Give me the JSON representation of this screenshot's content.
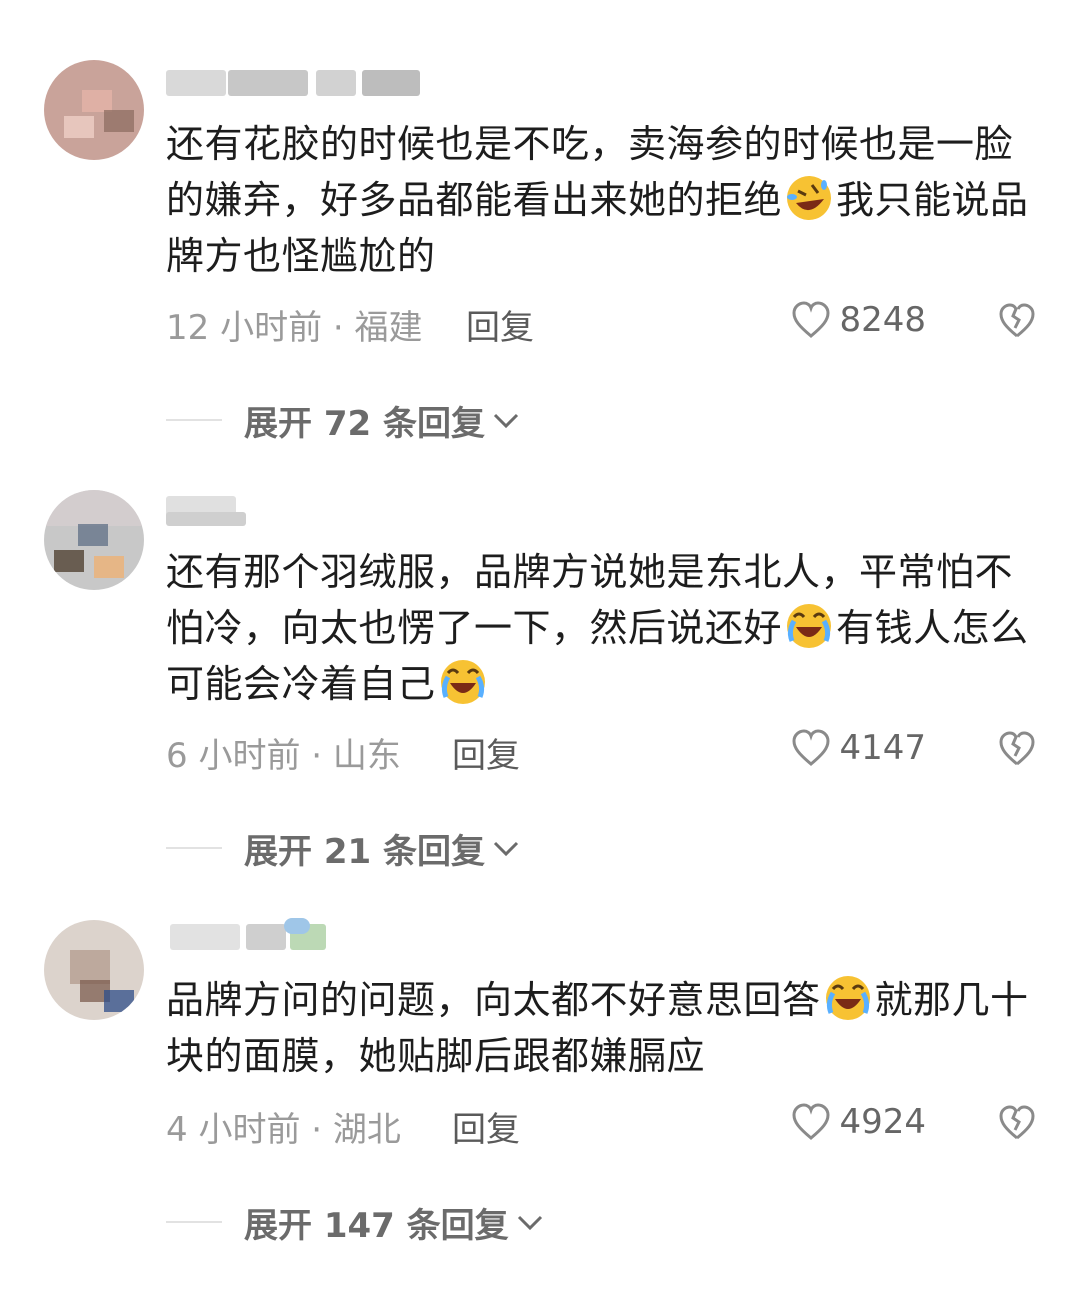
{
  "comments": [
    {
      "avatar_colors": [
        "#c9a39a",
        "#e6b4a8",
        "#8e6e62"
      ],
      "text_parts": [
        "还有花胶的时候也是不吃，卖海参的时候也是一脸的嫌弃，好多品都能看出来她的拒绝",
        "我只能说品牌方也怪尴尬的"
      ],
      "emoji": "rofl-emoji",
      "time_location": "12 小时前 · 福建",
      "reply_label": "回复",
      "likes": "8248",
      "expand_label": "展开 72 条回复"
    },
    {
      "avatar_colors": [
        "#c8c8c8",
        "#5f6f85",
        "#f0b070"
      ],
      "text_parts": [
        "还有那个羽绒服，品牌方说她是东北人，平常怕不怕冷，向太也愣了一下，然后说还好",
        "有钱人怎么可能会冷着自己"
      ],
      "emoji": "crying-laughing-emoji",
      "time_location": "6 小时前 · 山东",
      "reply_label": "回复",
      "likes": "4147",
      "expand_label": "展开 21 条回复"
    },
    {
      "avatar_colors": [
        "#dcd3cc",
        "#b39b8e",
        "#7d5d50"
      ],
      "text_parts": [
        "品牌方问的问题，向太都不好意思回答",
        "就那几十块的面膜，她贴脚后跟都嫌膈应"
      ],
      "emoji": "crying-laughing-emoji",
      "time_location": "4 小时前 · 湖北",
      "reply_label": "回复",
      "likes": "4924",
      "expand_label": "展开 147 条回复"
    }
  ],
  "icons": {
    "like": "heart-outline-icon",
    "dislike": "broken-heart-icon",
    "expand": "chevron-down-icon"
  },
  "colors": {
    "text": "#1d1d1d",
    "meta": "#9a9a9a",
    "expand": "#6b6b6b",
    "emoji_face": "#f7c233"
  }
}
